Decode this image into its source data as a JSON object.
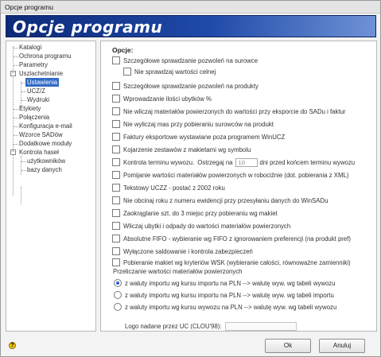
{
  "window": {
    "title": "Opcje programu"
  },
  "banner": {
    "title": "Opcje programu"
  },
  "tree": {
    "items": [
      {
        "label": "Katalogi",
        "selected": false
      },
      {
        "label": "Ochrona programu",
        "selected": false
      },
      {
        "label": "Parametry",
        "selected": false
      },
      {
        "label": "Uszlachetnianie",
        "selected": false
      },
      {
        "label": "Ustawienia",
        "selected": true
      },
      {
        "label": "UCZ/Z",
        "selected": false
      },
      {
        "label": "Wydruki",
        "selected": false
      },
      {
        "label": "Etykiety",
        "selected": false
      },
      {
        "label": "Połączenia",
        "selected": false
      },
      {
        "label": "Konfiguracja e-mail",
        "selected": false
      },
      {
        "label": "Wzorce SADów",
        "selected": false
      },
      {
        "label": "Dodatkowe moduły",
        "selected": false
      },
      {
        "label": "Kontrola haseł",
        "selected": false
      },
      {
        "label": "użytkowników",
        "selected": false
      },
      {
        "label": "bazy danych",
        "selected": false
      }
    ]
  },
  "options": {
    "heading": "Opcje:",
    "checkboxes": [
      {
        "label": "Szczegółowe sprawdzanie pozwoleń na surowce",
        "checked": false
      },
      {
        "label": "Nie sprawdzaj wartości celnej",
        "checked": false
      },
      {
        "label": "Szczegółowe sprawdzanie pozwoleń na produkty",
        "checked": false
      },
      {
        "label": "Wprowadzanie ilości ubytków %",
        "checked": false
      },
      {
        "label": "Nie wliczaj materiałów powierzonych do wartości przy eksporcie do SADu i faktur",
        "checked": false
      },
      {
        "label": "Nie wyliczaj mas przy pobieraniu surowców na produkt",
        "checked": false
      },
      {
        "label": "Faktury eksportowe wystawiane poza programem WinUCZ",
        "checked": false
      },
      {
        "label": "Kojarzenie zestawów z makietami wg symbolu",
        "checked": false
      },
      {
        "label": "Kontrola terminu wywozu.",
        "checked": false
      },
      {
        "label": "Pomijanie wartości materiałów powierzonych w robociźnie (dot. pobierania z XML)",
        "checked": false
      },
      {
        "label": "Tekstowy UCZZ - postać z 2002 roku",
        "checked": false
      },
      {
        "label": "Nie obcinaj roku z numeru ewidencji przy przesyłaniu danych do WinSADu",
        "checked": false
      },
      {
        "label": "Zaokrąglanie szt. do 3 miejsc przy pobieraniu wg makiet",
        "checked": false
      },
      {
        "label": "Wliczaj ubytki i odpady do wartości materiałów powierzonych",
        "checked": false
      },
      {
        "label": "Absolutne FIFO - wybieranie wg FIFO z ignorowaniem preferencji (na produkt pref)",
        "checked": false
      },
      {
        "label": "Wyłączone saldowanie i kontrola zabezpieczeń",
        "checked": false
      },
      {
        "label": "Pobieranie makiet wg kryteriów WSK (wybieranie całości, równoważne zamienniki)",
        "checked": false
      }
    ],
    "deadline": {
      "warn_prefix": "Ostrzegaj na",
      "days_value": "10",
      "warn_suffix": "dni przed końcem terminu wywozu"
    },
    "recalc": {
      "label": "Przeliczanie wartości  materiałów powierzonych",
      "radios": [
        {
          "label": "z waluty importu wg kursu importu na PLN  --> walutę wyw. wg tabeli wywozu",
          "selected": true
        },
        {
          "label": "z waluty importu wg kursu importu na PLN  --> walutę wyw. wg tabeli importu",
          "selected": false
        },
        {
          "label": "z waluty importu wg kursu wywozu na PLN  --> walutę wyw. wg tabeli  wywozu",
          "selected": false
        }
      ]
    },
    "logo_label": "Logo nadane przez UC (CLOU'98):",
    "logo_value": ""
  },
  "buttons": {
    "ok": "Ok",
    "cancel": "Anuluj"
  },
  "colors": {
    "banner": "#1f4aa8",
    "selection": "#3169c6",
    "radio_dot": "#2a5bd7"
  },
  "icons": {
    "help": "help-icon"
  }
}
